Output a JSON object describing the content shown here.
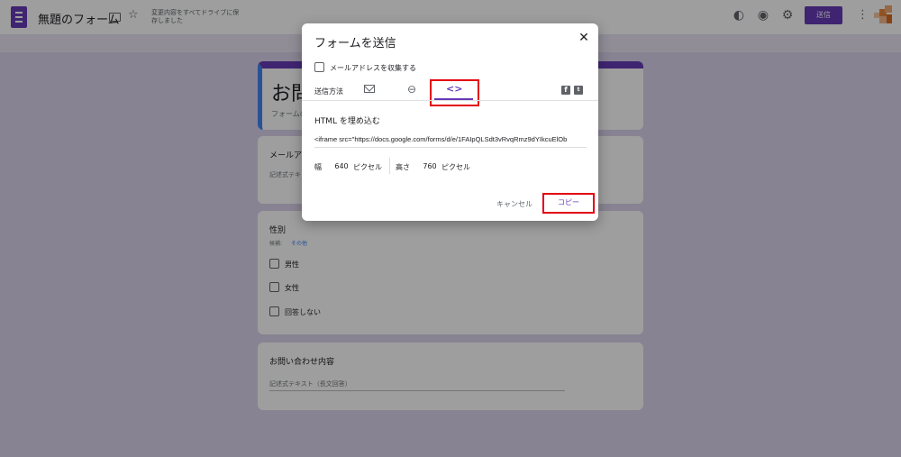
{
  "header": {
    "title": "無題のフォーム",
    "save_status": "変更内容をすべてドライブに保存しました",
    "send_label": "送信",
    "icons": [
      "forms-logo-icon",
      "folder-icon",
      "star-icon",
      "palette-icon",
      "eye-icon",
      "gear-icon",
      "more-vert-icon"
    ]
  },
  "form": {
    "title": "お問",
    "description": "フォームの",
    "questions": [
      {
        "title": "メールア",
        "answer": "記述式テキ"
      },
      {
        "title": "性別",
        "hint": "候補:",
        "hint_link": "その他",
        "options": [
          "男性",
          "女性",
          "回答しない"
        ]
      },
      {
        "title": "お問い合わせ内容",
        "answer": "記述式テキスト（長文回答）"
      }
    ]
  },
  "dialog": {
    "title": "フォームを送信",
    "close_glyph": "✕",
    "collect_email_label": "メールアドレスを収集する",
    "send_via_label": "送信方法",
    "embed_tab_glyph": "<>",
    "link_tab_glyph": "⊖",
    "facebook_glyph": "f",
    "twitter_glyph": "t",
    "embed_heading": "HTML を埋め込む",
    "embed_code": "<iframe src=\"https://docs.google.com/forms/d/e/1FAIpQLSdt3vRvqRmz9dYIkcuElOb",
    "width_label": "幅",
    "width_value": "640",
    "width_unit": "ピクセル",
    "height_label": "高さ",
    "height_value": "760",
    "height_unit": "ピクセル",
    "cancel_label": "キャンセル",
    "copy_label": "コピー",
    "accent_color": "#673ab7",
    "highlight_color": "#e3000f"
  }
}
